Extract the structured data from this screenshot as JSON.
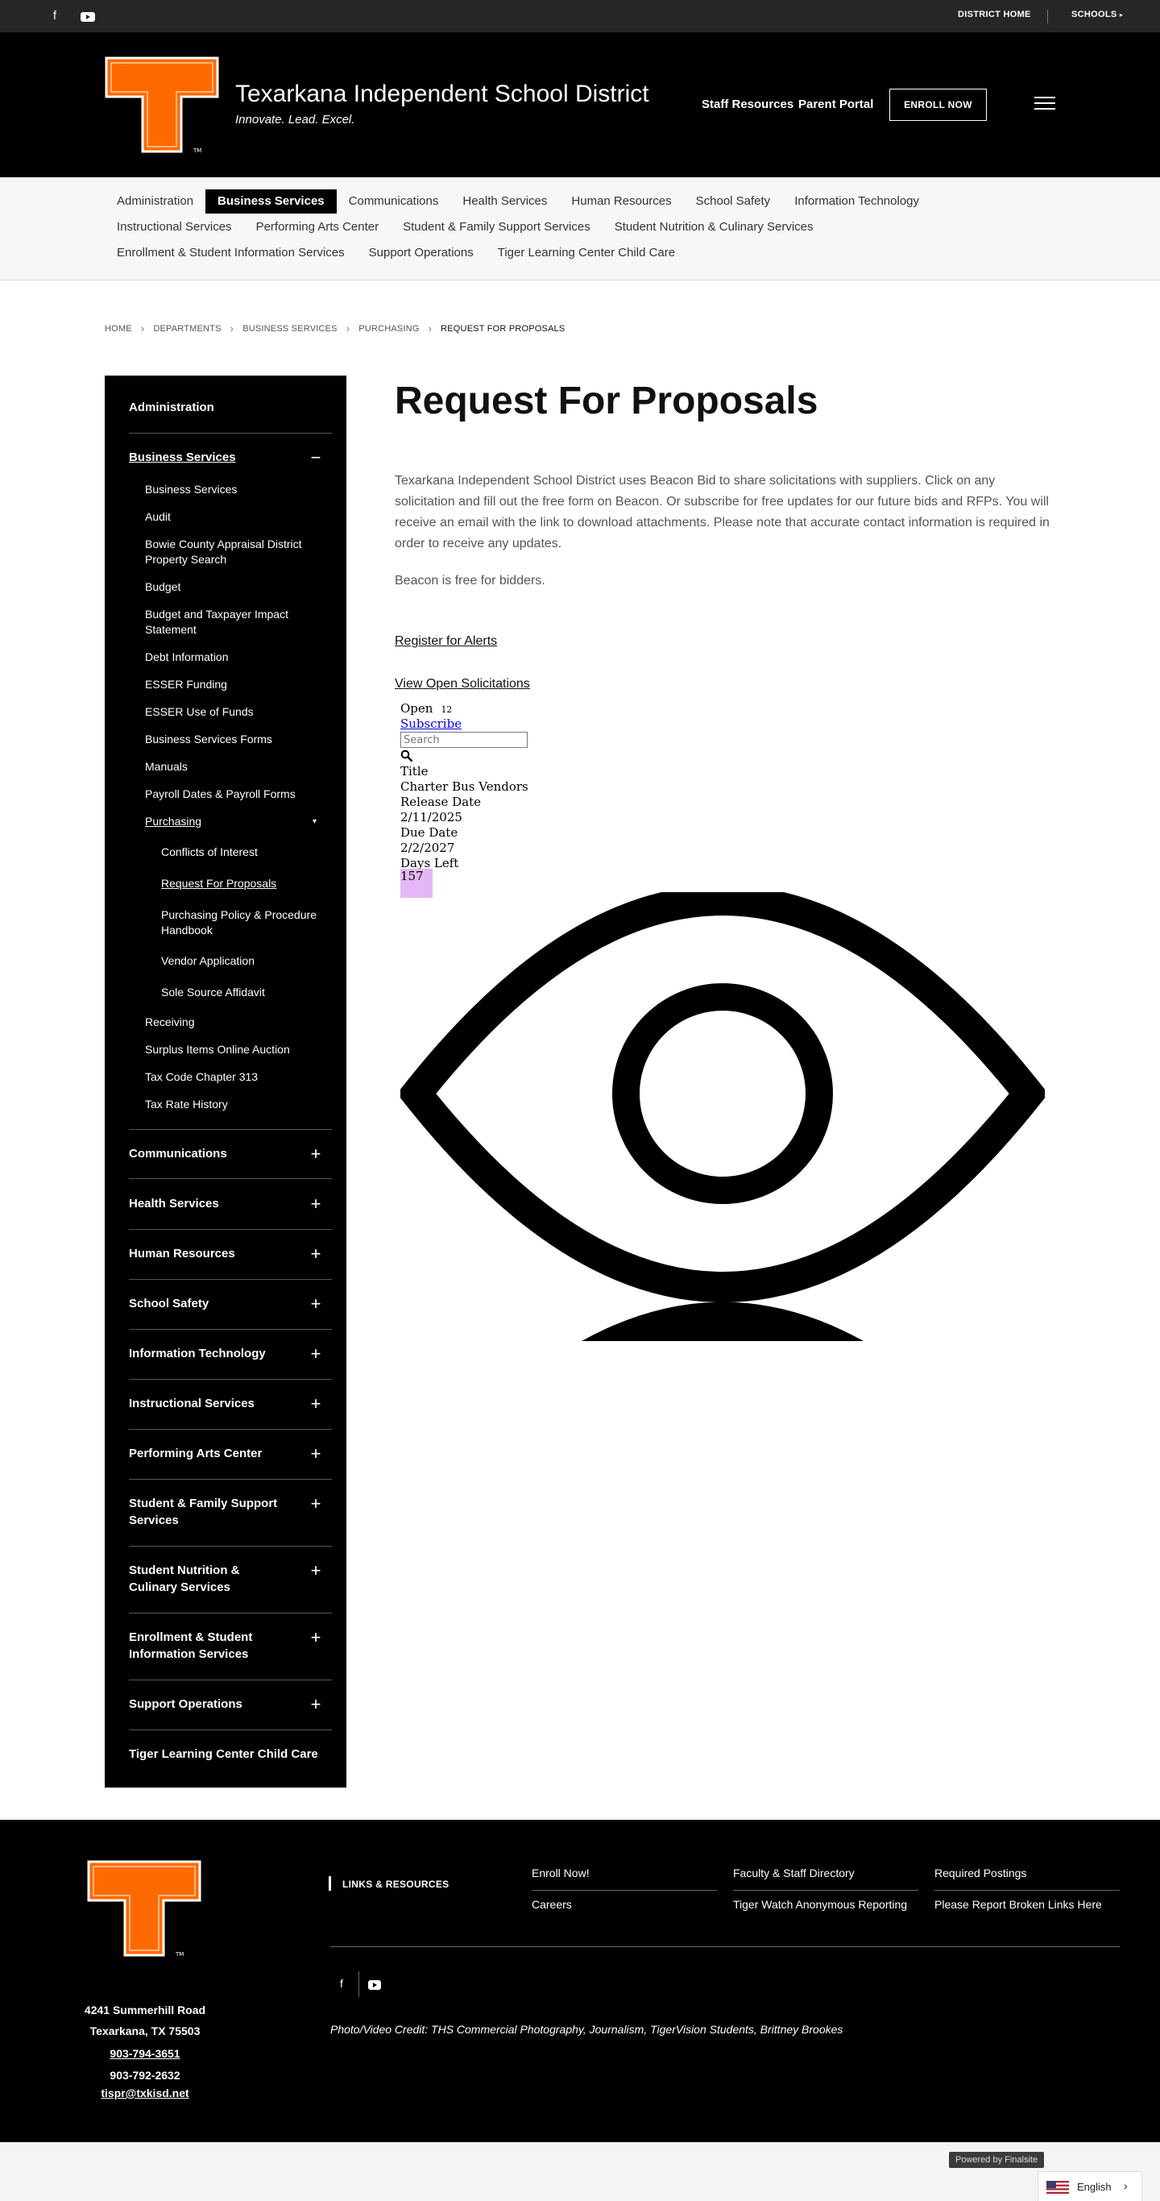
{
  "topbar": {
    "social": [
      "facebook-icon",
      "youtube-icon"
    ],
    "district_home": "DISTRICT HOME",
    "schools": "SCHOOLS"
  },
  "header": {
    "title": "Texarkana Independent School District",
    "tagline": "Innovate. Lead. Excel.",
    "links": [
      "Staff Resources",
      "Parent Portal"
    ],
    "enroll": "ENROLL NOW",
    "brand_color": "#ff6a00"
  },
  "deptnav": {
    "row1": [
      "Administration",
      "Business Services",
      "Communications",
      "Health Services",
      "Human Resources",
      "School Safety",
      "Information Technology"
    ],
    "row2": [
      "Instructional Services",
      "Performing Arts Center",
      "Student & Family Support Services",
      "Student Nutrition & Culinary Services"
    ],
    "row3": [
      "Enrollment & Student Information Services",
      "Support Operations",
      "Tiger Learning Center Child Care"
    ],
    "active": "Business Services"
  },
  "breadcrumb": [
    "HOME",
    "DEPARTMENTS",
    "BUSINESS SERVICES",
    "PURCHASING",
    "REQUEST FOR PROPOSALS"
  ],
  "sidebar": {
    "administration": "Administration",
    "business_services": "Business Services",
    "business_children": [
      "Business Services",
      "Audit",
      "Bowie County Appraisal District Property Search",
      "Budget",
      "Budget and Taxpayer Impact Statement",
      "Debt Information",
      "ESSER Funding",
      "ESSER Use of Funds",
      "Business Services Forms",
      "Manuals",
      "Payroll Dates & Payroll Forms",
      "Purchasing"
    ],
    "purchasing_children": [
      "Conflicts of Interest",
      "Request For Proposals",
      "Purchasing Policy & Procedure Handbook",
      "Vendor Application",
      "Sole Source Affidavit"
    ],
    "business_children_after": [
      "Receiving",
      "Surplus Items Online Auction",
      "Tax Code Chapter 313",
      "Tax Rate History"
    ],
    "groups": [
      "Communications",
      "Health Services",
      "Human Resources",
      "School Safety",
      "Information Technology",
      "Instructional Services",
      "Performing Arts Center",
      "Student & Family Support Services",
      "Student Nutrition & Culinary Services",
      "Enrollment & Student Information Services",
      "Support Operations"
    ],
    "last": "Tiger Learning Center Child Care"
  },
  "main": {
    "title": "Request For Proposals",
    "intro": "Texarkana Independent School District uses Beacon Bid to share solicitations with suppliers. Click on any solicitation and fill out the free form on Beacon. Or subscribe for free updates for our future bids and RFPs. You will receive an email with the link to download attachments. Please note that accurate contact information is required in order to receive any updates.",
    "intro2": "Beacon is free for bidders.",
    "register": "Register for Alerts",
    "view": "View Open Solicitations"
  },
  "widget": {
    "open_label": "Open",
    "open_count": "12",
    "subscribe": "Subscribe",
    "search_placeholder": "Search",
    "title_label": "Title",
    "title_value": "Charter Bus Vendors",
    "release_label": "Release Date",
    "release_value": "2/11/2025",
    "due_label": "Due Date",
    "due_value": "2/2/2027",
    "days_label": "Days Left",
    "days_value": "157",
    "days_color": "#e3b8f5"
  },
  "footer": {
    "address1": "4241 Summerhill Road",
    "address2": "Texarkana, TX  75503",
    "phone1": "903-794-3651",
    "phone2": "903-792-2632",
    "email": "tispr@txkisd.net",
    "links_title": "LINKS & RESOURCES",
    "links": [
      [
        "Enroll Now!",
        "Faculty & Staff Directory",
        "Required Postings"
      ],
      [
        "Careers",
        "Tiger Watch Anonymous Reporting",
        "Please Report Broken Links Here"
      ]
    ],
    "credit": "Photo/Video Credit: THS Commercial Photography, Journalism, TigerVision Students, Brittney Brookes"
  },
  "bottom": {
    "powered": "Powered by Finalsite",
    "language": "English"
  }
}
